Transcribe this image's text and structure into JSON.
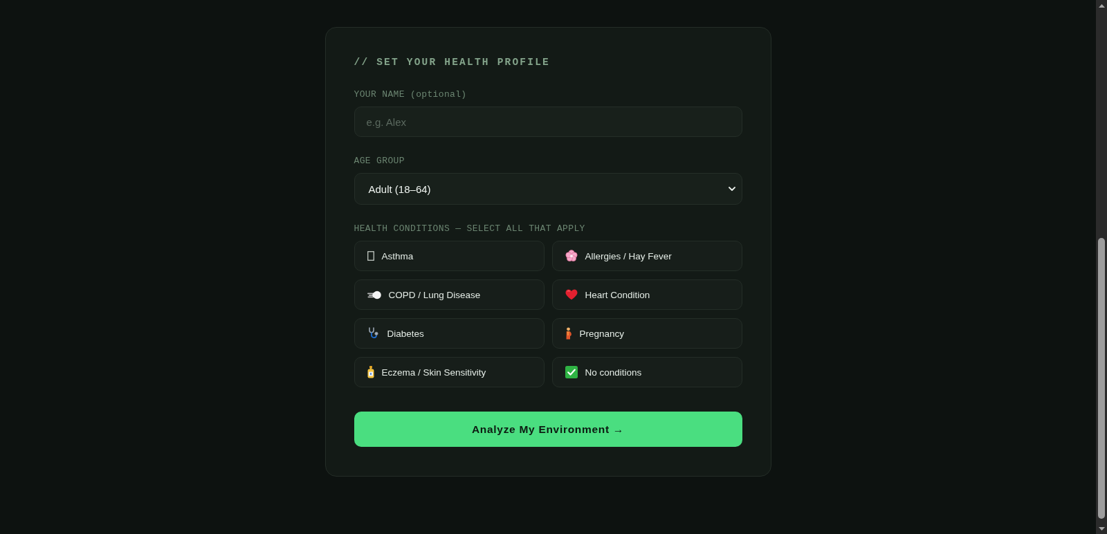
{
  "profile_form": {
    "heading": "// SET YOUR HEALTH PROFILE",
    "name_field": {
      "label": "YOUR NAME (optional)",
      "placeholder": "e.g. Alex"
    },
    "age_group": {
      "label": "AGE GROUP",
      "value": "Adult (18–64)"
    },
    "conditions": {
      "label": "HEALTH CONDITIONS — SELECT ALL THAT APPLY",
      "options": [
        {
          "label": "Asthma",
          "selected": false
        },
        {
          "label": "Allergies / Hay Fever",
          "selected": false
        },
        {
          "label": "COPD / Lung Disease",
          "selected": false
        },
        {
          "label": "Heart Condition",
          "selected": false
        },
        {
          "label": "Diabetes",
          "selected": false
        },
        {
          "label": "Pregnancy",
          "selected": false
        },
        {
          "label": "Eczema / Skin Sensitivity",
          "selected": false
        },
        {
          "label": "No conditions",
          "selected": false
        }
      ]
    },
    "submit_button": {
      "label": "Analyze My Environment →"
    }
  }
}
